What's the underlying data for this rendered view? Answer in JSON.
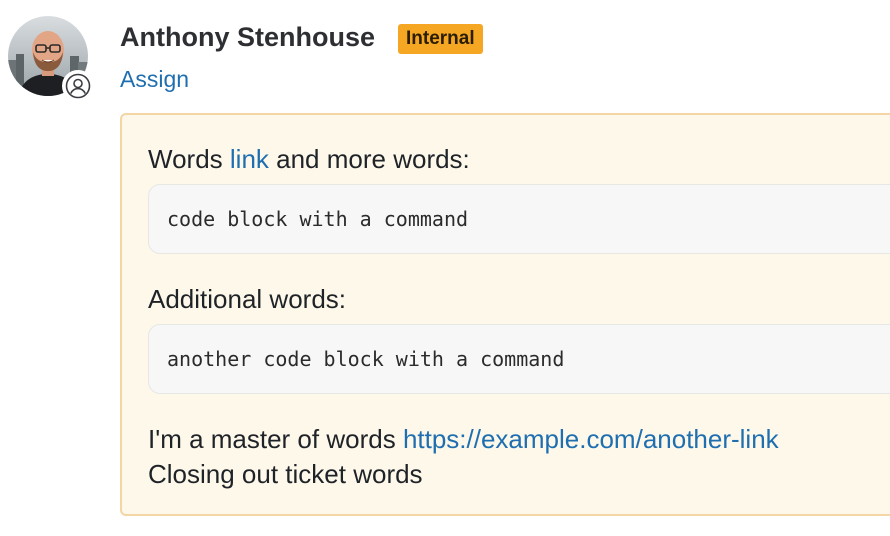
{
  "comment": {
    "author": "Anthony Stenhouse",
    "badge": "Internal",
    "assign_label": "Assign",
    "body": {
      "p1": {
        "before": "Words",
        "link": "link",
        "after": "and more words:"
      },
      "code1": "code block with a command",
      "p2": "Additional words:",
      "code2": "another code block with a command",
      "p3": {
        "before": "I'm a master of words",
        "link": "https://example.com/another-link"
      },
      "p4": "Closing out ticket words"
    }
  },
  "icons": {
    "avatar": "user-photo",
    "role_badge": "person-icon"
  },
  "colors": {
    "badge_bg": "#f5a623",
    "link": "#1f6fb0",
    "note_bg": "#fdf8ea",
    "note_border": "#f3d5a6",
    "code_bg": "#f6f7f6"
  }
}
